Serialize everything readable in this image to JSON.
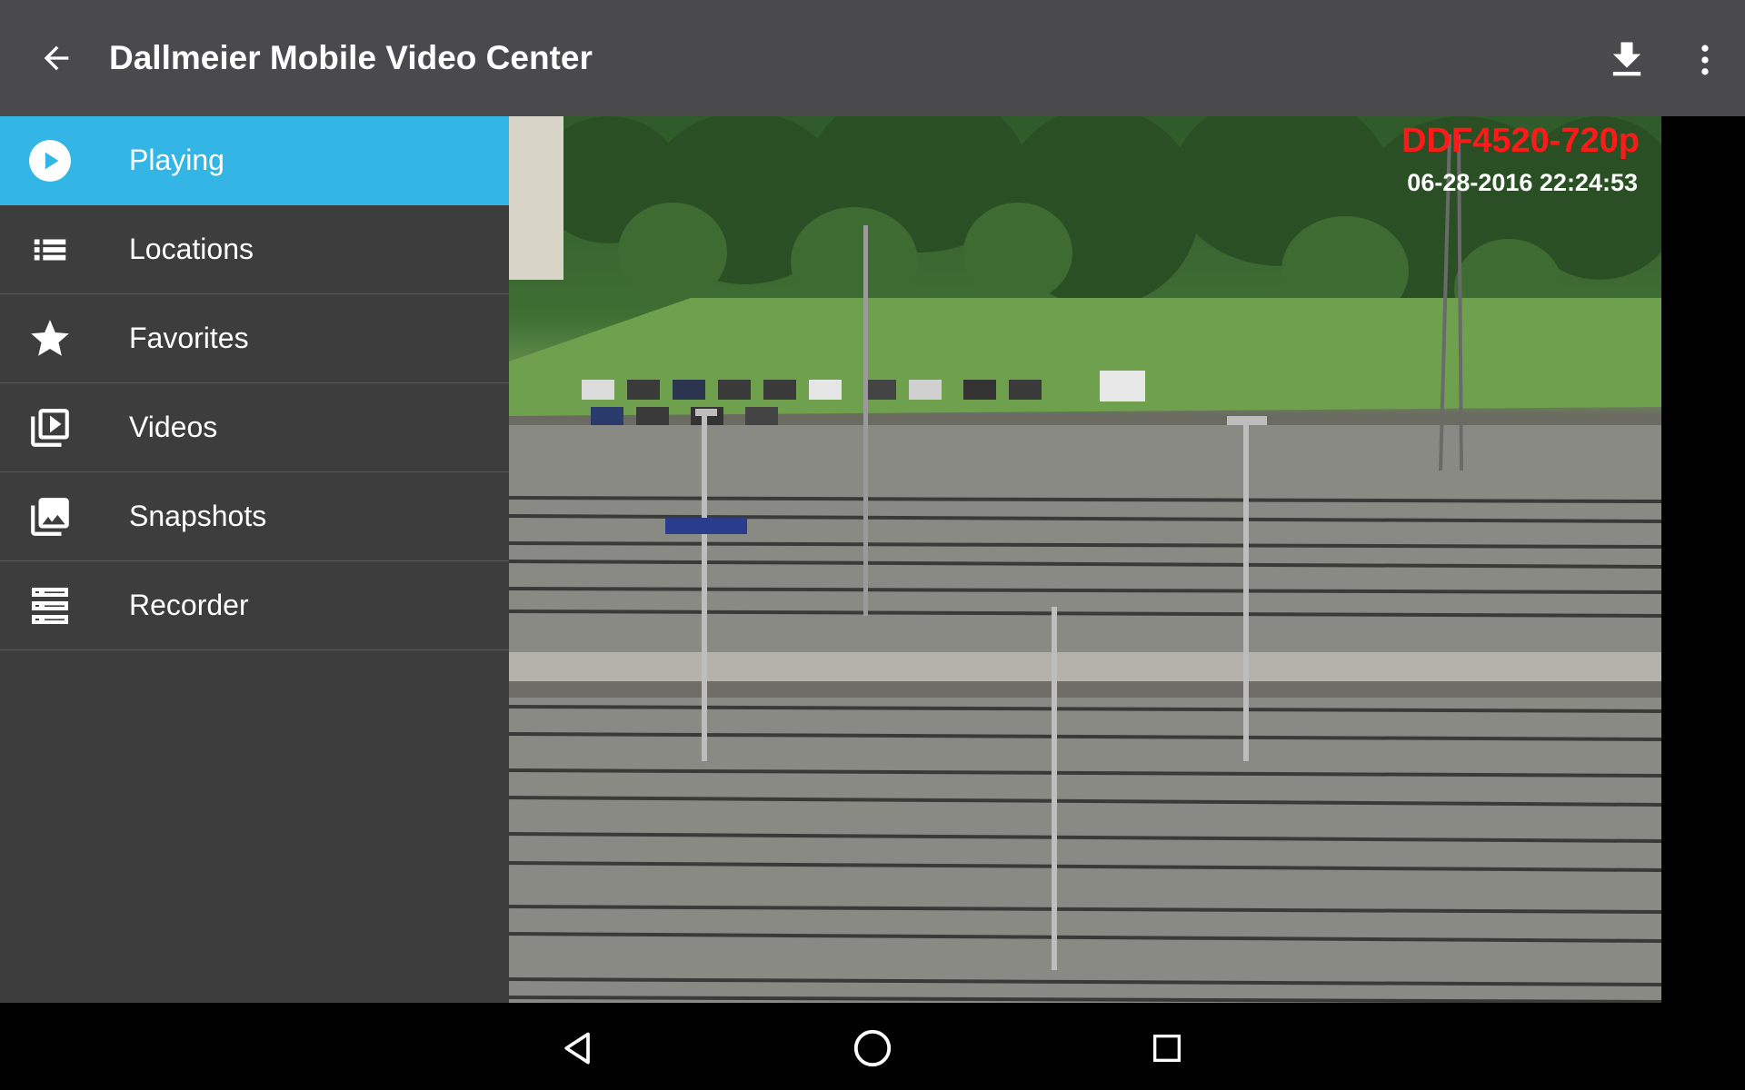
{
  "appbar": {
    "title": "Dallmeier Mobile Video Center",
    "back_icon": "arrow-back-icon",
    "download_icon": "download-icon",
    "more_icon": "more-vert-icon"
  },
  "drawer": {
    "items": [
      {
        "label": "Playing",
        "icon": "play-circle-icon",
        "active": true
      },
      {
        "label": "Locations",
        "icon": "list-icon",
        "active": false
      },
      {
        "label": "Favorites",
        "icon": "star-icon",
        "active": false
      },
      {
        "label": "Videos",
        "icon": "video-library-icon",
        "active": false
      },
      {
        "label": "Snapshots",
        "icon": "photo-library-icon",
        "active": false
      },
      {
        "label": "Recorder",
        "icon": "recorder-icon",
        "active": false
      }
    ]
  },
  "video": {
    "camera_name": "DDF4520-720p",
    "timestamp": "06-28-2016 22:24:53"
  },
  "system_nav": {
    "back_icon": "nav-back-icon",
    "home_icon": "nav-home-icon",
    "recents_icon": "nav-recents-icon"
  },
  "colors": {
    "appbar": "#4a4a4c",
    "drawer": "#3d3d3d",
    "active": "#33b5e5",
    "camera_label": "#ff1a1a"
  }
}
